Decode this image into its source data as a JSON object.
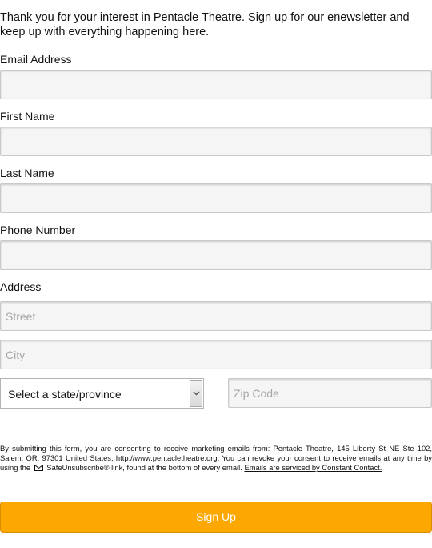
{
  "intro": {
    "text": "Thank you for your interest in Pentacle Theatre. Sign up for our enewsletter and keep up with everything happening here."
  },
  "form": {
    "email_label": "Email Address",
    "email_value": "",
    "first_name_label": "First Name",
    "first_name_value": "",
    "last_name_label": "Last Name",
    "last_name_value": "",
    "phone_label": "Phone Number",
    "phone_value": "",
    "address_label": "Address",
    "street_placeholder": "Street",
    "city_placeholder": "City",
    "state_selected": "Select a state/province",
    "zip_placeholder": "Zip Code"
  },
  "disclaimer": {
    "text_before_icon": "By submitting this form, you are consenting to receive marketing emails from: Pentacle Theatre, 145 Liberty St NE Ste 102, Salem, OR, 97301 United States, http://www.pentacletheatre.org. You can revoke your consent to receive emails at any time by using the",
    "icon": "envelope-icon",
    "text_after_icon": "SafeUnsubscribe® link, found at the bottom of every email.",
    "link_text": "Emails are serviced by Constant Contact."
  },
  "submit": {
    "label": "Sign Up"
  },
  "colors": {
    "button_bg": "#fca800",
    "button_text": "#ffffff",
    "field_bg": "#f5f5f5",
    "field_border": "#c9c9c9"
  }
}
